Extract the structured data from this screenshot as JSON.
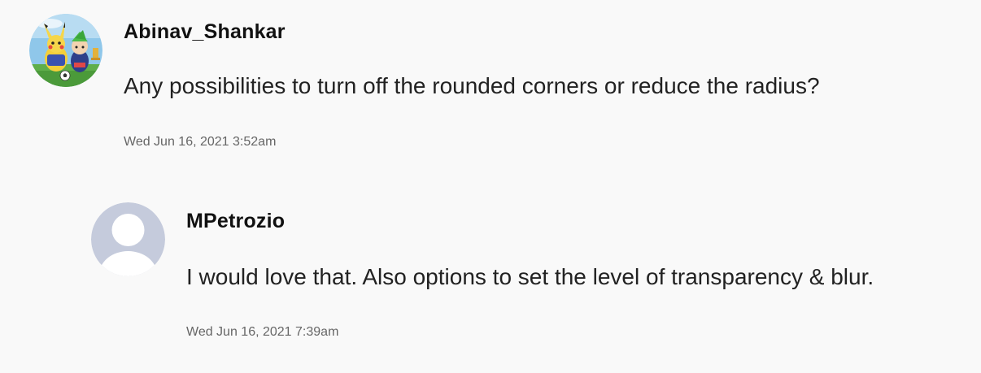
{
  "comments": [
    {
      "username": "Abinav_Shankar",
      "avatar": "cartoon-avatar-image",
      "body": "Any possibilities to turn off the rounded corners or reduce the radius?",
      "timestamp": "Wed Jun 16, 2021 3:52am"
    },
    {
      "username": "MPetrozio",
      "avatar": "default-user-avatar",
      "body": "I would love that. Also options to set the level of transparency & blur.",
      "timestamp": "Wed Jun 16, 2021 7:39am"
    }
  ],
  "colors": {
    "background": "#f9f9f9",
    "default_avatar_bg": "#c5cbdc",
    "default_avatar_fg": "#ffffff",
    "timestamp": "#666666"
  }
}
